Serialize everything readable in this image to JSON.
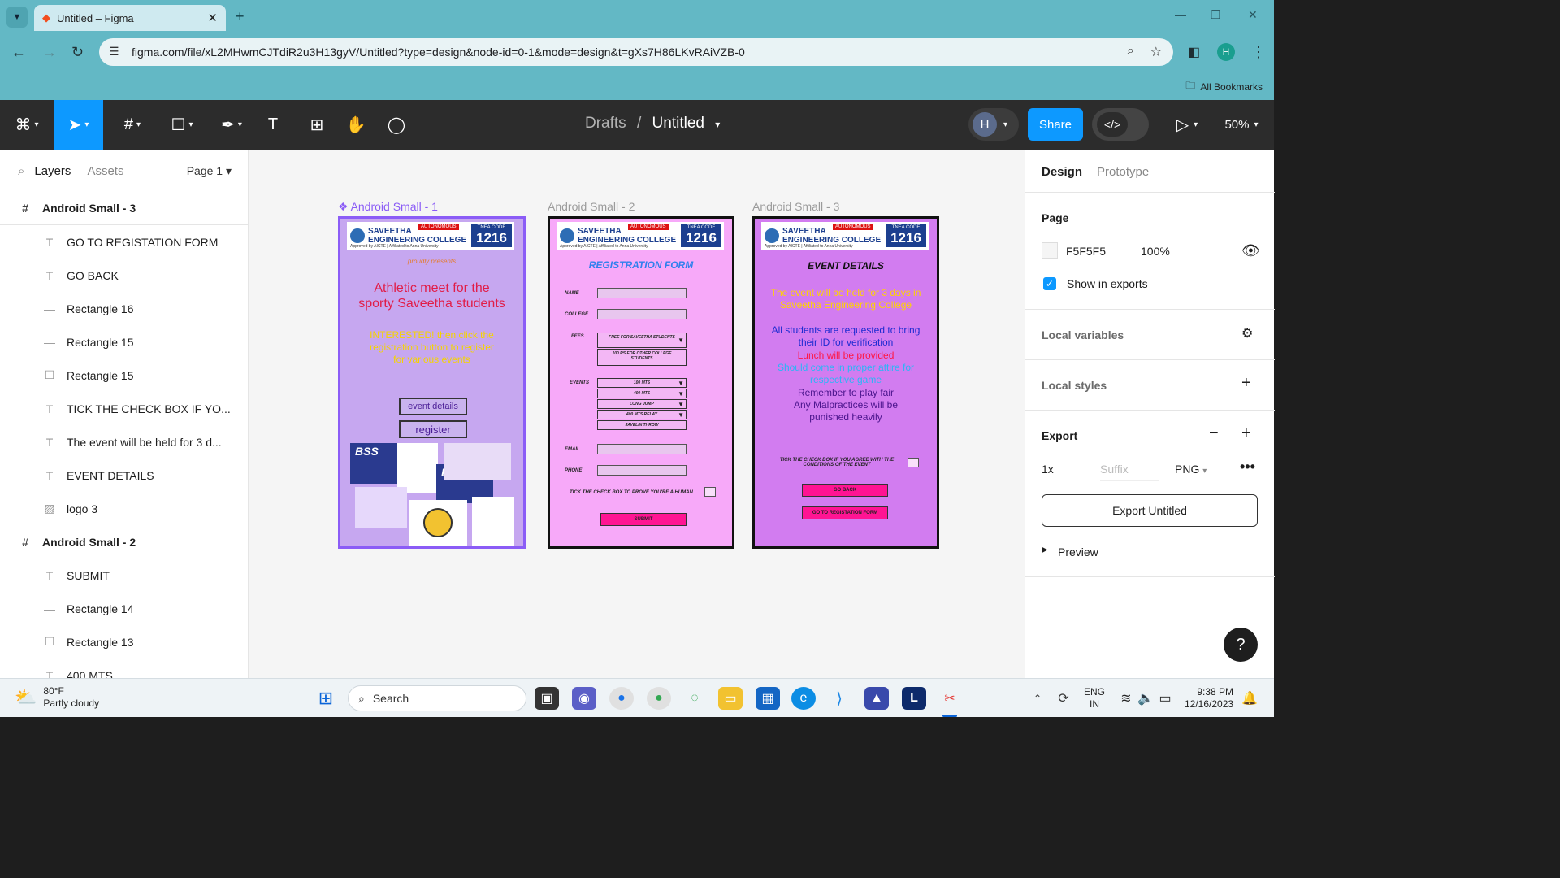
{
  "browser": {
    "tab_title": "Untitled – Figma",
    "tab_close": "✕",
    "new_tab": "+",
    "url": "figma.com/file/xL2MHwmCJTdiR2u3H13gyV/Untitled?type=design&node-id=0-1&mode=design&t=gXs7H86LKvRAiVZB-0",
    "bookmarks": "All Bookmarks",
    "profile": "H"
  },
  "toolbar": {
    "breadcrumb_parent": "Drafts",
    "breadcrumb_sep": "/",
    "file_name": "Untitled",
    "avatar": "H",
    "share": "Share",
    "zoom": "50%"
  },
  "left_panel": {
    "tabs": {
      "layers": "Layers",
      "assets": "Assets",
      "page": "Page 1"
    },
    "layers": [
      {
        "label": "Android Small - 3",
        "type": "frame",
        "icon": "#"
      },
      {
        "label": "GO TO REGISTATION FORM",
        "type": "text",
        "icon": "T"
      },
      {
        "label": "GO BACK",
        "type": "text",
        "icon": "T"
      },
      {
        "label": "Rectangle 16",
        "type": "line",
        "icon": "—"
      },
      {
        "label": "Rectangle 15",
        "type": "line",
        "icon": "—"
      },
      {
        "label": "Rectangle 15",
        "type": "rect",
        "icon": "☐"
      },
      {
        "label": "TICK THE CHECK BOX IF YO...",
        "type": "text",
        "icon": "T"
      },
      {
        "label": "The event will be held for 3 d...",
        "type": "text",
        "icon": "T"
      },
      {
        "label": "EVENT DETAILS",
        "type": "text",
        "icon": "T"
      },
      {
        "label": "logo 3",
        "type": "image",
        "icon": "▨"
      },
      {
        "label": "Android Small - 2",
        "type": "frame",
        "icon": "#"
      },
      {
        "label": "SUBMIT",
        "type": "text",
        "icon": "T"
      },
      {
        "label": "Rectangle 14",
        "type": "line",
        "icon": "—"
      },
      {
        "label": "Rectangle 13",
        "type": "rect",
        "icon": "☐"
      },
      {
        "label": "400 MTS",
        "type": "text",
        "icon": "T"
      }
    ]
  },
  "canvas": {
    "frame1": {
      "label": "Android Small - 1",
      "proudly": "proudly presents",
      "headline": "Athletic meet for the sporty Saveetha students",
      "interested": "INTERESTED! then click the registration button to register for various events",
      "details_btn": "event details",
      "register_btn": "register"
    },
    "frame2": {
      "label": "Android Small - 2",
      "title": "REGISTRATION FORM",
      "labels": {
        "name": "NAME",
        "college": "COLLEGE",
        "fees": "FEES",
        "events": "EVENTS",
        "email": "EMAIL",
        "phone": "PHONE"
      },
      "fees": [
        "FREE FOR SAVEETHA STUDENTS",
        "100 RS FOR OTHER COLLEGE STUDENTS"
      ],
      "events": [
        "100 MTS",
        "400 MTS",
        "LONG JUMP",
        "400 MTS RELAY",
        "JAVELIN THROW"
      ],
      "human": "TICK THE CHECK BOX TO PROVE YOU'RE A HUMAN",
      "submit": "SUBMIT"
    },
    "frame3": {
      "label": "Android Small - 3",
      "title": "EVENT DETAILS",
      "p1": "The event will be held for 3 days in Saveetha Engineering College",
      "p2": "All students are requested to bring their ID for verification",
      "p3": "Lunch will be provided",
      "p4": "Should come in proper attire for respective game",
      "p5": "Remember to play fair",
      "p6": "Any Malpractices will be punished heavily",
      "agree": "TICK THE CHECK BOX IF YOU AGREE WITH THE CONDITIONS OF THE EVENT",
      "go_back": "GO BACK",
      "go_reg": "GO TO REGISTATION FORM"
    },
    "logo": {
      "name1": "SAVEETHA",
      "name2": "ENGINEERING COLLEGE",
      "autonomous": "AUTONOMOUS",
      "approved": "Approved by AICTE | Affiliated to Anna University",
      "tnea": "TNEA CODE",
      "code": "1216"
    }
  },
  "right_panel": {
    "tabs": {
      "design": "Design",
      "prototype": "Prototype"
    },
    "page_title": "Page",
    "page_color": "F5F5F5",
    "page_opacity": "100%",
    "show_exports": "Show in exports",
    "local_variables": "Local variables",
    "local_styles": "Local styles",
    "export_title": "Export",
    "export_scale": "1x",
    "suffix_placeholder": "Suffix",
    "format": "PNG",
    "export_btn": "Export Untitled",
    "preview": "Preview"
  },
  "taskbar": {
    "temp": "80°F",
    "weather": "Partly cloudy",
    "search": "Search",
    "lang1": "ENG",
    "lang2": "IN",
    "time": "9:38 PM",
    "date": "12/16/2023"
  }
}
